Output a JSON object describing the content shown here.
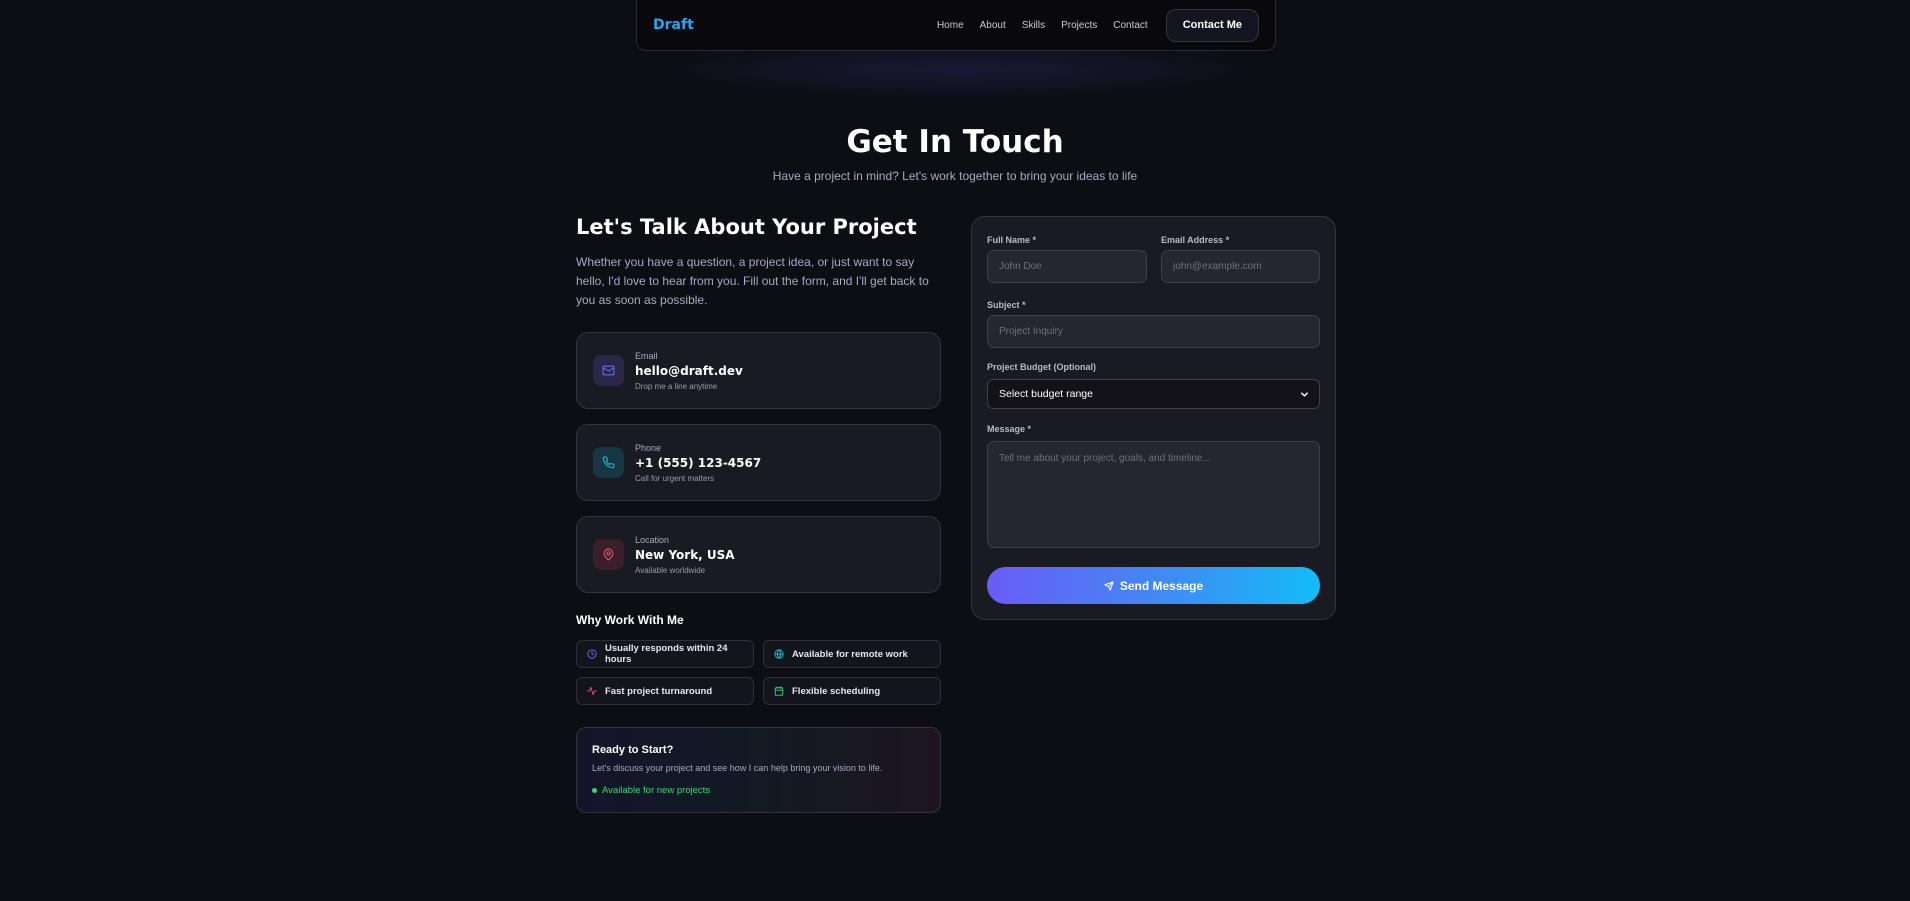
{
  "nav": {
    "logo": "Draft",
    "links": [
      "Home",
      "About",
      "Skills",
      "Projects",
      "Contact"
    ],
    "cta": "Contact Me"
  },
  "header": {
    "title": "Get In Touch",
    "subtitle": "Have a project in mind? Let's work together to bring your ideas to life"
  },
  "intro": {
    "heading": "Let's Talk About Your Project",
    "description": "Whether you have a question, a project idea, or just want to say hello, I'd love to hear from you. Fill out the form, and I'll get back to you as soon as possible."
  },
  "contacts": [
    {
      "label": "Email",
      "value": "hello@draft.dev",
      "note": "Drop me a line anytime",
      "icon": "mail-icon",
      "color": "#6b6bf0"
    },
    {
      "label": "Phone",
      "value": "+1 (555) 123-4567",
      "note": "Call for urgent matters",
      "icon": "phone-icon",
      "color": "#1fb6d8"
    },
    {
      "label": "Location",
      "value": "New York, USA",
      "note": "Available worldwide",
      "icon": "map-pin-icon",
      "color": "#e05a7a"
    }
  ],
  "why": {
    "heading": "Why Work With Me",
    "items": [
      {
        "text": "Usually responds within 24 hours",
        "icon": "clock-icon",
        "color": "#7b6bf5"
      },
      {
        "text": "Available for remote work",
        "icon": "globe-icon",
        "color": "#1fb6d8"
      },
      {
        "text": "Fast project turnaround",
        "icon": "zap-icon",
        "color": "#e05a7a"
      },
      {
        "text": "Flexible scheduling",
        "icon": "calendar-icon",
        "color": "#3ed47a"
      }
    ]
  },
  "ready": {
    "title": "Ready to Start?",
    "description": "Let's discuss your project and see how I can help bring your vision to life.",
    "status": "Available for new projects"
  },
  "form": {
    "name_label": "Full Name *",
    "name_placeholder": "John Doe",
    "email_label": "Email Address *",
    "email_placeholder": "john@example.com",
    "subject_label": "Subject *",
    "subject_placeholder": "Project Inquiry",
    "budget_label": "Project Budget (Optional)",
    "budget_selected": "Select budget range",
    "message_label": "Message *",
    "message_placeholder": "Tell me about your project, goals, and timeline...",
    "submit": "Send Message"
  },
  "colors": {
    "accent": "#2aa6f0",
    "background": "#0d0d14",
    "gradient_start": "#6a5cf6",
    "gradient_end": "#12bdf6",
    "status_green": "#3ed47a"
  }
}
